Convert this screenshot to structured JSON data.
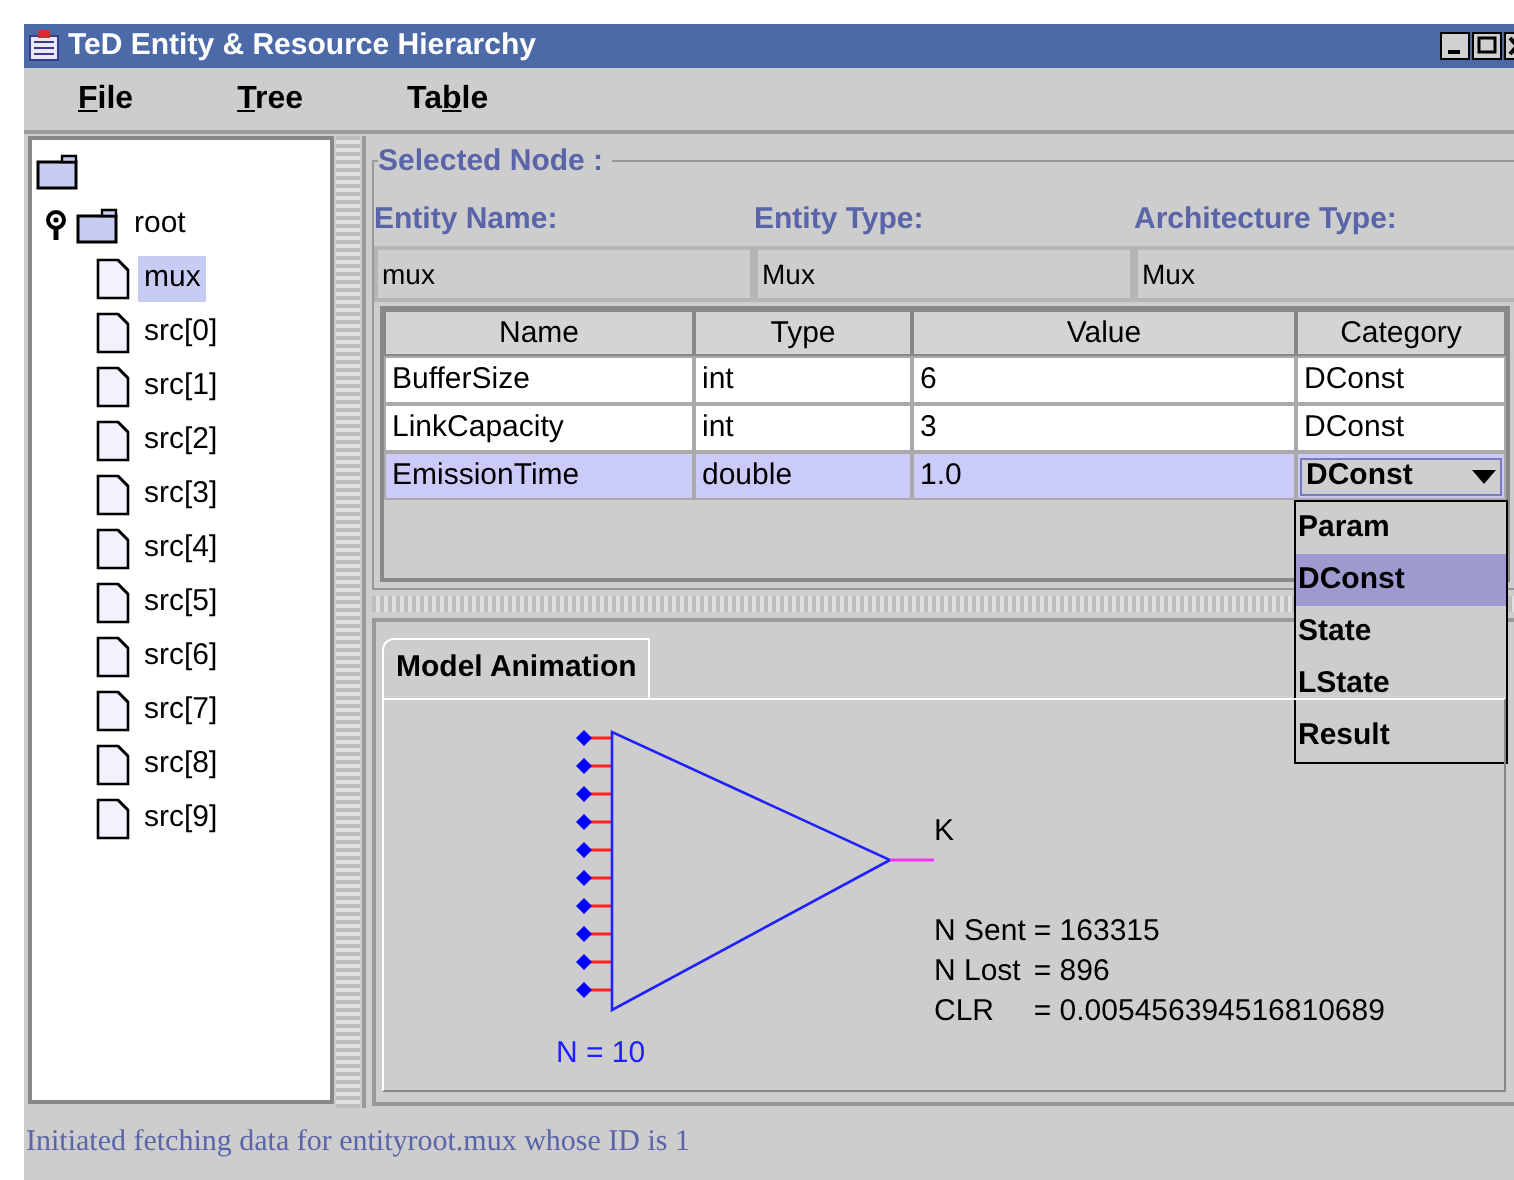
{
  "window": {
    "title": "TeD Entity & Resource Hierarchy"
  },
  "menu": [
    {
      "key": "F",
      "after": "ile"
    },
    {
      "key": "T",
      "after": "ree"
    },
    {
      "before": "Ta",
      "key": "b",
      "after": "le"
    }
  ],
  "tree": [
    {
      "kind": "folder",
      "expanded": true,
      "children": [
        {
          "kind": "folder",
          "label": "root",
          "expanded": true,
          "children": [
            {
              "kind": "leaf",
              "label": "mux",
              "selected": true
            },
            {
              "kind": "leaf",
              "label": "src[0]",
              "selected": false
            },
            {
              "kind": "leaf",
              "label": "src[1]",
              "selected": false
            },
            {
              "kind": "leaf",
              "label": "src[2]",
              "selected": false
            },
            {
              "kind": "leaf",
              "label": "src[3]",
              "selected": false
            },
            {
              "kind": "leaf",
              "label": "src[4]",
              "selected": false
            },
            {
              "kind": "leaf",
              "label": "src[5]",
              "selected": false
            },
            {
              "kind": "leaf",
              "label": "src[6]",
              "selected": false
            },
            {
              "kind": "leaf",
              "label": "src[7]",
              "selected": false
            },
            {
              "kind": "leaf",
              "label": "src[8]",
              "selected": false
            },
            {
              "kind": "leaf",
              "label": "src[9]",
              "selected": false
            }
          ]
        }
      ]
    }
  ],
  "selected_node": {
    "title": "Selected Node :",
    "fields": [
      {
        "label": "Entity Name:",
        "value": "mux"
      },
      {
        "label": "Entity Type:",
        "value": "Mux"
      },
      {
        "label": "Architecture Type:",
        "value": "Mux"
      }
    ],
    "table": {
      "columns": [
        "Name",
        "Type",
        "Value",
        "Category"
      ],
      "rows": [
        {
          "selected": false,
          "editing": false,
          "cells": [
            "BufferSize",
            "int",
            "6",
            "DConst"
          ]
        },
        {
          "selected": false,
          "editing": false,
          "cells": [
            "LinkCapacity",
            "int",
            "3",
            "DConst"
          ]
        },
        {
          "selected": true,
          "editing": true,
          "cells": [
            "EmissionTime",
            "double",
            "1.0",
            "DConst"
          ]
        }
      ],
      "dropdown": {
        "options": [
          {
            "label": "Param",
            "selected": false
          },
          {
            "label": "DConst",
            "selected": true
          },
          {
            "label": "State",
            "selected": false
          },
          {
            "label": "LState",
            "selected": false
          },
          {
            "label": "Result",
            "selected": false
          }
        ]
      }
    }
  },
  "animation": {
    "tabs": [
      {
        "label": "Model Animation",
        "selected": true
      }
    ],
    "output_label": "K",
    "input_count": "N = 10",
    "stats": [
      {
        "name": "N Sent",
        "value": "= 163315"
      },
      {
        "name": "N Lost",
        "value": "= 896"
      },
      {
        "name": "CLR",
        "value": "= 0.005456394516810689"
      }
    ]
  },
  "status_bar": "Initiated fetching data for entityroot.mux whose ID is 1"
}
